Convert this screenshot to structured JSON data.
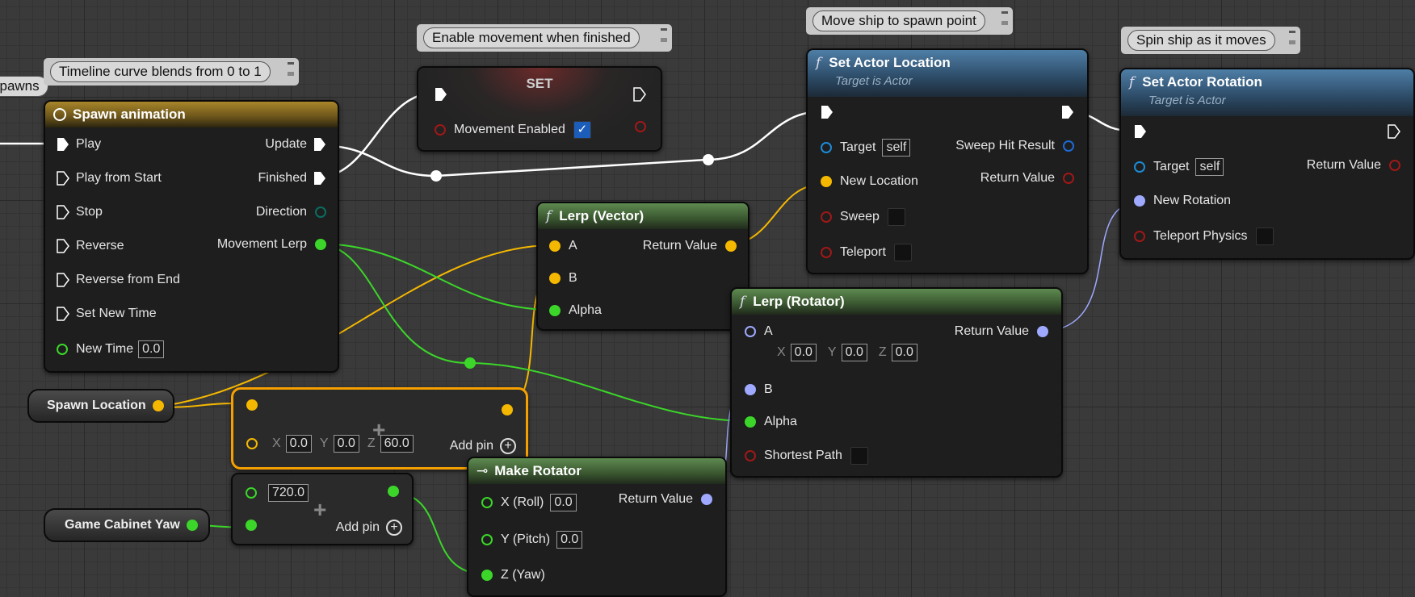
{
  "comments": {
    "spawns": "spawns",
    "timeline": "Timeline curve blends from 0 to 1",
    "enable": "Enable movement when finished",
    "move": "Move ship to spawn point",
    "spin": "Spin ship as it moves"
  },
  "timeline_node": {
    "title": "Spawn animation",
    "inputs": [
      "Play",
      "Play from Start",
      "Stop",
      "Reverse",
      "Reverse from End",
      "Set New Time"
    ],
    "new_time_label": "New Time",
    "new_time_value": "0.0",
    "outputs": [
      "Update",
      "Finished",
      "Direction",
      "Movement Lerp"
    ]
  },
  "set_node": {
    "title": "SET",
    "var_label": "Movement Enabled",
    "checked": true
  },
  "set_location": {
    "title": "Set Actor Location",
    "subtitle": "Target is Actor",
    "target_label": "Target",
    "target_value": "self",
    "new_location": "New Location",
    "sweep": "Sweep",
    "teleport": "Teleport",
    "sweep_hit": "Sweep Hit Result",
    "return_value": "Return Value"
  },
  "set_rotation": {
    "title": "Set Actor Rotation",
    "subtitle": "Target is Actor",
    "target_label": "Target",
    "target_value": "self",
    "new_rotation": "New Rotation",
    "teleport_physics": "Teleport Physics",
    "return_value": "Return Value"
  },
  "lerp_vector": {
    "title": "Lerp (Vector)",
    "a": "A",
    "b": "B",
    "alpha": "Alpha",
    "return_value": "Return Value"
  },
  "lerp_rotator": {
    "title": "Lerp (Rotator)",
    "a": "A",
    "x_label": "X",
    "x": "0.0",
    "y_label": "Y",
    "y": "0.0",
    "z_label": "Z",
    "z": "0.0",
    "b": "B",
    "alpha": "Alpha",
    "shortest_path": "Shortest Path",
    "return_value": "Return Value"
  },
  "spawn_location": "Spawn Location",
  "add_vector": {
    "x_label": "X",
    "x": "0.0",
    "y_label": "Y",
    "y": "0.0",
    "z_label": "Z",
    "z": "60.0",
    "add_pin": "Add pin"
  },
  "add_float": {
    "value": "720.0",
    "add_pin": "Add pin"
  },
  "game_cabinet_yaw": "Game Cabinet Yaw",
  "make_rotator": {
    "title": "Make Rotator",
    "x": "X (Roll)",
    "x_value": "0.0",
    "y": "Y (Pitch)",
    "y_value": "0.0",
    "z": "Z (Yaw)",
    "return_value": "Return Value"
  },
  "colors": {
    "exec": "#ffffff",
    "vector": "#f5b800",
    "float": "#3bd629",
    "rotator": "#9ea9ff",
    "bool": "#8e0f0f",
    "object": "#1e8ad6",
    "selection": "#f5a000"
  }
}
